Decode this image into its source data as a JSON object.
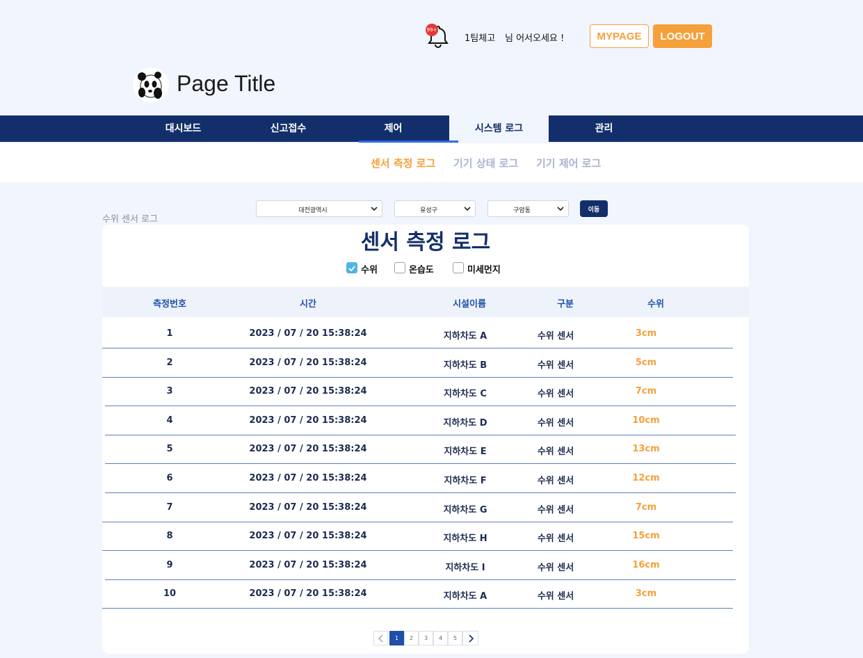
{
  "header": {
    "notification_badge": "99+",
    "user_name": "1팀체고",
    "greeting": "님 어서오세요 !",
    "mypage_label": "MYPAGE",
    "logout_label": "LOGOUT",
    "page_title": "Page Title",
    "logo_icon": "panda-logo-icon"
  },
  "nav": {
    "items": [
      {
        "label": "대시보드"
      },
      {
        "label": "신고접수"
      },
      {
        "label": "제어"
      },
      {
        "label": "시스템 로그"
      },
      {
        "label": "관리"
      }
    ],
    "active_index": 3
  },
  "subnav": {
    "items": [
      {
        "label": "센서 측정 로그"
      },
      {
        "label": "기기 상태 로그"
      },
      {
        "label": "기기 제어 로그"
      }
    ],
    "active_index": 0
  },
  "filters": {
    "section_label": "수위 센서 로그",
    "city": "대전광역시",
    "district": "유성구",
    "dong": "구암동",
    "go_label": "이동"
  },
  "log": {
    "title": "센서 측정 로그",
    "checkboxes": [
      {
        "label": "수위",
        "checked": true
      },
      {
        "label": "온습도",
        "checked": false
      },
      {
        "label": "미세먼지",
        "checked": false
      }
    ],
    "columns": [
      "측정번호",
      "시간",
      "시설이름",
      "구분",
      "수위"
    ],
    "rows": [
      {
        "no": "1",
        "time": "2023 / 07 / 20 15:38:24",
        "facility": "지하차도 A",
        "type": "수위 센서",
        "value": "3cm"
      },
      {
        "no": "2",
        "time": "2023 / 07 / 20 15:38:24",
        "facility": "지하차도 B",
        "type": "수위 센서",
        "value": "5cm"
      },
      {
        "no": "3",
        "time": "2023 / 07 / 20 15:38:24",
        "facility": "지하차도 C",
        "type": "수위 센서",
        "value": "7cm"
      },
      {
        "no": "4",
        "time": "2023 / 07 / 20 15:38:24",
        "facility": "지하차도 D",
        "type": "수위 센서",
        "value": "10cm"
      },
      {
        "no": "5",
        "time": "2023 / 07 / 20 15:38:24",
        "facility": "지하차도 E",
        "type": "수위 센서",
        "value": "13cm"
      },
      {
        "no": "6",
        "time": "2023 / 07 / 20 15:38:24",
        "facility": "지하차도 F",
        "type": "수위 센서",
        "value": "12cm"
      },
      {
        "no": "7",
        "time": "2023 / 07 / 20 15:38:24",
        "facility": "지하차도 G",
        "type": "수위 센서",
        "value": "7cm"
      },
      {
        "no": "8",
        "time": "2023 / 07 / 20 15:38:24",
        "facility": "지하차도 H",
        "type": "수위 센서",
        "value": "15cm"
      },
      {
        "no": "9",
        "time": "2023 / 07 / 20 15:38:24",
        "facility": "지하차도 I",
        "type": "수위 센서",
        "value": "16cm"
      },
      {
        "no": "10",
        "time": "2023 / 07 / 20 15:38:24",
        "facility": "지하차도 A",
        "type": "수위 센서",
        "value": "3cm"
      }
    ]
  },
  "pagination": {
    "pages": [
      "1",
      "2",
      "3",
      "4",
      "5"
    ],
    "current": "1"
  },
  "colors": {
    "navy": "#132f6b",
    "accent_orange": "#f5a03a",
    "link_blue": "#1f4fa8"
  }
}
